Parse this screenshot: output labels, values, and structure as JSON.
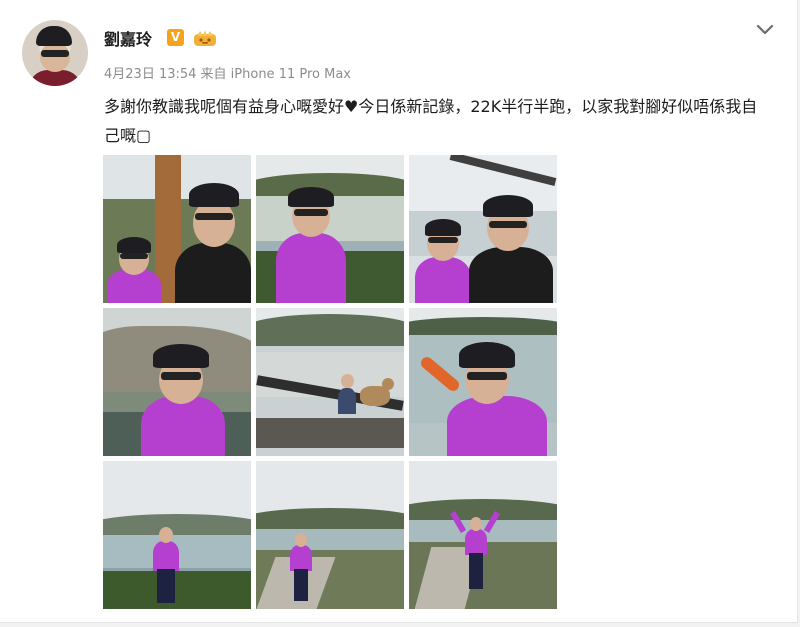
{
  "post": {
    "username": "劉嘉玲",
    "verified_badge": "V",
    "meta": "4月23日 13:54 来自 iPhone 11 Pro Max",
    "text": "多謝你教識我呢個有益身心嘅愛好♥今日係新記錄，22K半行半跑，以家我對腳好似唔係我自己嘅▢"
  },
  "icons": {
    "verified": "verified-v-icon",
    "member": "crown-icon",
    "menu": "chevron-down-icon"
  },
  "colors": {
    "verified": "#f7a21b",
    "member": "#f0b03a",
    "jacket": "#b53fcf",
    "text": "#1d1d1d",
    "meta": "#8c8c8c"
  },
  "photos": [
    {
      "id": "photo-1",
      "scene": "two-people-selfie-signpost"
    },
    {
      "id": "photo-2",
      "scene": "woman-selfie-beach"
    },
    {
      "id": "photo-3",
      "scene": "two-people-selfie-pier"
    },
    {
      "id": "photo-4",
      "scene": "woman-selfie-rocks"
    },
    {
      "id": "photo-5",
      "scene": "man-with-dog-pier"
    },
    {
      "id": "photo-6",
      "scene": "woman-selfie-waving-sea"
    },
    {
      "id": "photo-7",
      "scene": "woman-standing-hillside"
    },
    {
      "id": "photo-8",
      "scene": "woman-walking-path"
    },
    {
      "id": "photo-9",
      "scene": "woman-arms-raised-path"
    }
  ]
}
